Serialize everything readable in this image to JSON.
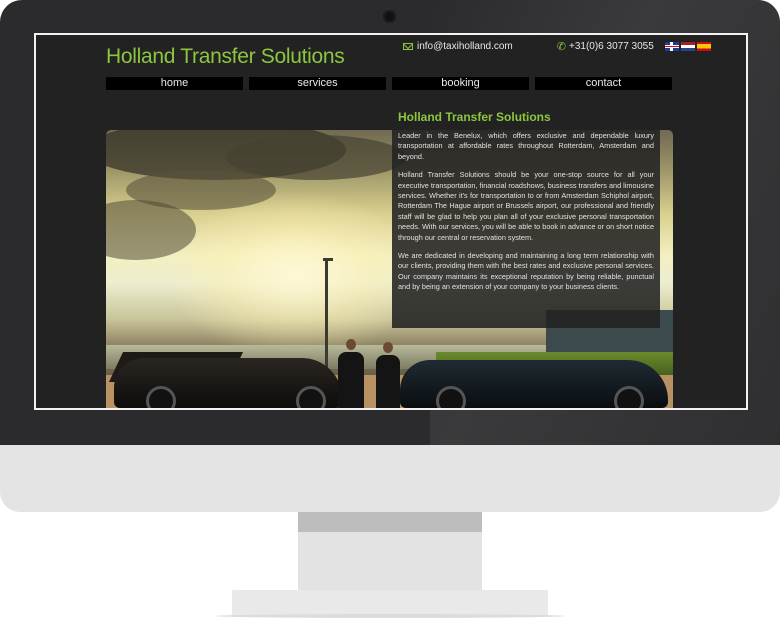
{
  "site": {
    "title": "Holland Transfer Solutions",
    "email": "info@taxiholland.com",
    "phone": "+31(0)6 3077 3055",
    "languages": [
      "English",
      "Nederlands",
      "Español"
    ]
  },
  "nav": {
    "items": [
      "home",
      "services",
      "booking",
      "contact"
    ]
  },
  "info": {
    "title": "Holland Transfer Solutions",
    "paragraphs": [
      "Leader in the Benelux, which offers exclusive and dependable luxury transportation at affordable rates throughout Rotterdam, Amsterdam and beyond.",
      "Holland Transfer Solutions should be your one-stop source for all your executive transportation, financial roadshows, business transfers and limousine services. Whether it's for transportation to or from Amsterdam Schiphol airport, Rotterdam The Hague airport or Brussels airport, our professional and friendly staff will be glad to help you plan all of your exclusive personal transportation needs. With our services, you will be able to book in advance or on short notice through our central or reservation system.",
      "We are dedicated in developing and maintaining a long term relationship with our clients, providing them with the best rates and exclusive personal services. Our company maintains its exceptional reputation by being reliable, punctual and by being an extension of your company to your business clients."
    ]
  },
  "colors": {
    "accent": "#8cc63f",
    "background": "#222222",
    "nav_background": "#000000"
  }
}
